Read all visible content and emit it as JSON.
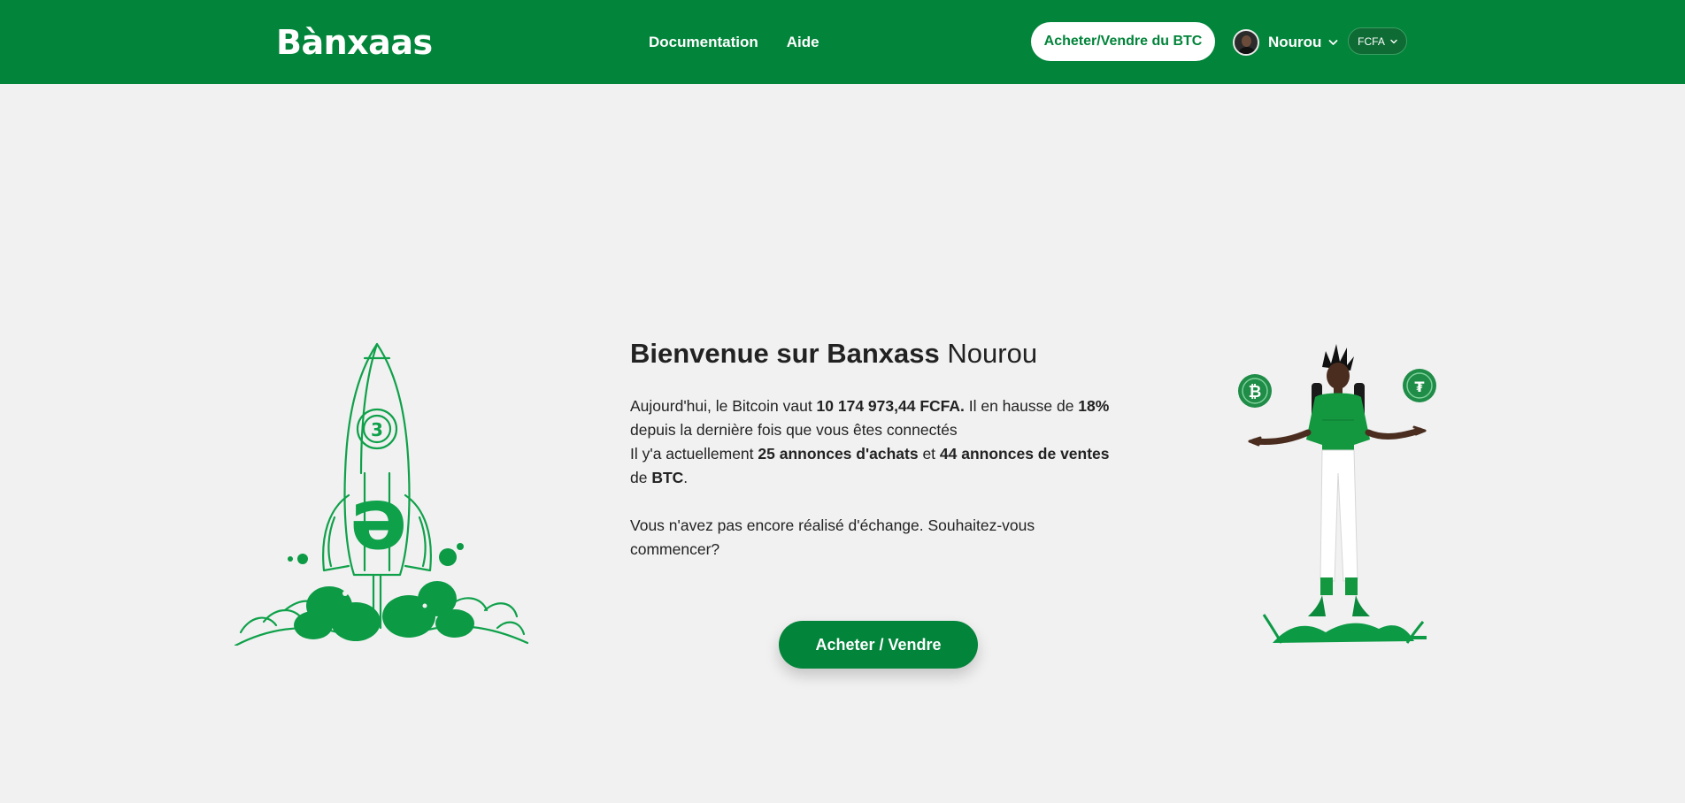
{
  "brand": {
    "logo_text": "Bànxaas",
    "accent": "#02843a"
  },
  "nav": {
    "links": [
      {
        "label": "Documentation"
      },
      {
        "label": "Aide"
      }
    ],
    "cta_label": "Acheter/Vendre du BTC",
    "user": {
      "name": "Nourou",
      "avatar": "user-avatar"
    },
    "currency": "FCFA"
  },
  "welcome": {
    "title_bold": "Bienvenue sur Banxass",
    "title_name": "Nourou",
    "line1_prefix": "Aujourd'hui, le Bitcoin vaut ",
    "btc_price": "10 174 973,44 FCFA.",
    "line1_mid": " Il en hausse de ",
    "change_pct": "18%",
    "line1_suffix": " depuis la dernière fois que vous êtes connectés",
    "line2_prefix": "Il y'a actuellement ",
    "buy_ads": "25 annonces d'achats",
    "line2_mid": " et ",
    "sell_ads": "44 annonces de ventes",
    "line2_de": " de ",
    "asset": "BTC",
    "line2_end": ".",
    "prompt": "Vous n'avez pas encore réalisé d'échange. Souhaitez-vous commencer?"
  },
  "cta_main_label": "Acheter / Vendre",
  "illustrations": {
    "left": "rocket-illustration",
    "right": "person-crypto-illustration"
  }
}
